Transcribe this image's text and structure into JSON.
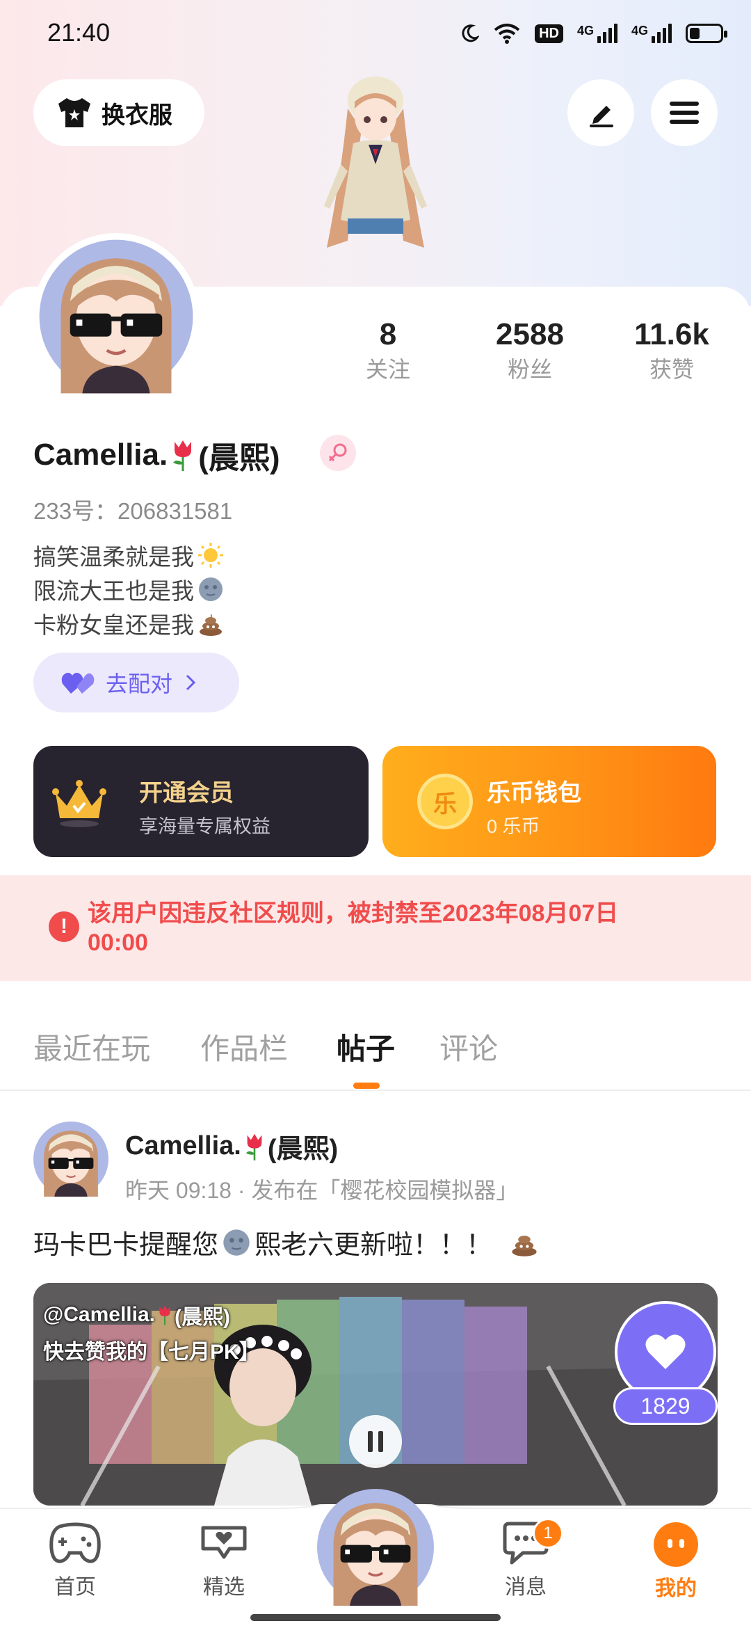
{
  "status_bar": {
    "time": "21:40",
    "hd_badge": "HD",
    "network_1": "4G",
    "network_2": "4G"
  },
  "header": {
    "outfit_label": "换衣服"
  },
  "profile": {
    "stats": [
      {
        "value": "8",
        "label": "关注"
      },
      {
        "value": "2588",
        "label": "粉丝"
      },
      {
        "value": "11.6k",
        "label": "获赞"
      }
    ],
    "name": "Camellia.",
    "name_suffix": "(晨熙)",
    "uid": "233号：206831581",
    "bio": [
      "搞笑温柔就是我",
      "限流大王也是我",
      "卡粉女皇还是我"
    ],
    "pair_label": "去配对"
  },
  "vip": {
    "title": "开通会员",
    "subtitle": "享海量专属权益"
  },
  "wallet": {
    "title": "乐币钱包",
    "subtitle": "0 乐币",
    "coin_char": "乐"
  },
  "ban_notice": {
    "text": "该用户因违反社区规则，被封禁至2023年08月07日 00:00",
    "icon": "!"
  },
  "tabs": [
    {
      "label": "最近在玩",
      "active": false
    },
    {
      "label": "作品栏",
      "active": false
    },
    {
      "label": "帖子",
      "active": true
    },
    {
      "label": "评论",
      "active": false
    }
  ],
  "post": {
    "author": "Camellia.",
    "author_suffix": "(晨熙)",
    "meta": "昨天 09:18 · 发布在「樱花校园模拟器」",
    "text": "玛卡巴卡提醒您",
    "text_2": "熙老六更新啦！！！",
    "video_overlay_line1": "@Camellia.",
    "video_overlay_line1_suffix": "(晨熙)",
    "video_overlay_line2": "快去赞我的【七月PK】",
    "like_count": "1829"
  },
  "bottom_nav": [
    {
      "label": "首页",
      "icon": "gamepad-icon",
      "active": false
    },
    {
      "label": "精选",
      "icon": "heart-chat-icon",
      "active": false
    },
    {
      "label": "",
      "icon": "avatar-center",
      "active": false
    },
    {
      "label": "消息",
      "icon": "message-icon",
      "active": false,
      "badge": "1"
    },
    {
      "label": "我的",
      "icon": "me-face-icon",
      "active": true
    }
  ],
  "colors": {
    "accent": "#ff7d10",
    "ban": "#f04c4c",
    "pair": "#6b5ff0",
    "like": "#7d6ff5"
  }
}
